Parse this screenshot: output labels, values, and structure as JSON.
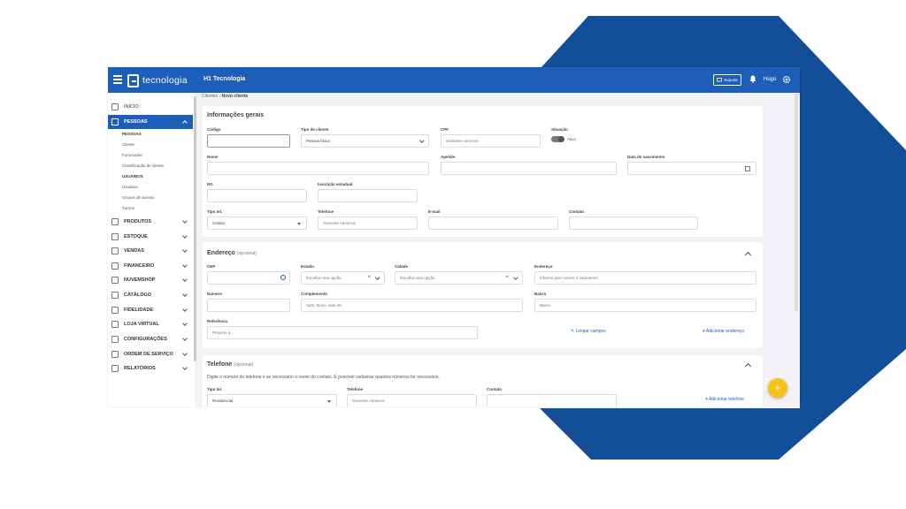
{
  "app": {
    "logo_text": "tecnologia",
    "company": "H1 Tecnologia",
    "support_label": "Suporte",
    "user": "Hugo",
    "colors": {
      "primary": "#1d5fb8",
      "deco": "#134e99",
      "fab": "#f5c31a"
    }
  },
  "sidebar": {
    "items": [
      {
        "label": "INÍCIO",
        "icon": "home-icon"
      },
      {
        "label": "PESSOAS",
        "icon": "people-icon"
      },
      {
        "label": "PRODUTOS",
        "icon": "box-icon"
      },
      {
        "label": "ESTOQUE",
        "icon": "stock-icon"
      },
      {
        "label": "VENDAS",
        "icon": "cart-icon"
      },
      {
        "label": "FINANCEIRO",
        "icon": "money-icon"
      },
      {
        "label": "NUVEMSHOP",
        "icon": "store-icon"
      },
      {
        "label": "CATÁLOGO",
        "icon": "catalog-icon"
      },
      {
        "label": "FIDELIDADE",
        "icon": "loyalty-icon"
      },
      {
        "label": "LOJA VIRTUAL",
        "icon": "shop-icon"
      },
      {
        "label": "CONFIGURAÇÕES",
        "icon": "gear-icon"
      },
      {
        "label": "ORDEM DE SERVIÇO",
        "icon": "service-icon"
      },
      {
        "label": "RELATÓRIOS",
        "icon": "report-icon"
      }
    ],
    "sub_items": [
      "PESSOAS",
      "Cliente",
      "Fornecedor",
      "Classificação de cliente",
      "USUÁRIOS",
      "Usuários",
      "Grupos de acesso",
      "Turnos"
    ]
  },
  "breadcrumb": {
    "parent": "Clientes",
    "current": "Novo cliente"
  },
  "general": {
    "title": "Informações gerais",
    "codigo": "Código",
    "tipo_cliente": "Tipo de cliente",
    "tipo_cliente_value": "Pessoa física",
    "cpf": "CPF",
    "cpf_placeholder": "Somente números",
    "situacao": "Situação",
    "situacao_value": "Ativo",
    "nome": "Nome",
    "apelido": "Apelido",
    "nascimento": "Data de nascimento",
    "rg": "RG",
    "ie": "Inscrição estadual",
    "tipo_tel": "Tipo tel.",
    "tipo_tel_value": "Celular",
    "telefone": "Telefone",
    "telefone_placeholder": "Somente números",
    "email": "E-mail",
    "contato": "Contato"
  },
  "address": {
    "title": "Endereço",
    "optional": "(opcional)",
    "cep": "CEP",
    "estado": "Estado",
    "estado_placeholder": "Escolha uma opção",
    "cidade": "Cidade",
    "cidade_placeholder": "Escolha uma opção",
    "endereco": "Endereço",
    "endereco_placeholder": "Informe pelo menos 3 caracteres",
    "numero": "Número",
    "complemento": "Complemento",
    "complemento_placeholder": "Apto, bloco, sala etc",
    "bairro": "Bairro",
    "bairro_placeholder": "Bairro",
    "referencia": "Referência",
    "referencia_placeholder": "Próximo a...",
    "clear": "Limpar campos",
    "add": "Adicionar endereço"
  },
  "phone": {
    "title": "Telefone",
    "optional": "(opcional)",
    "hint": "Digite o número do telefone e se necessário o nome do contato. É possível cadastrar quantos números for necessário.",
    "tipo_tel": "Tipo tel.",
    "tipo_tel_value": "Residencial",
    "telefone": "Telefone",
    "telefone_placeholder": "Somente números",
    "contato": "Contato",
    "add": "Adicionar telefone"
  },
  "fab_label": "+"
}
